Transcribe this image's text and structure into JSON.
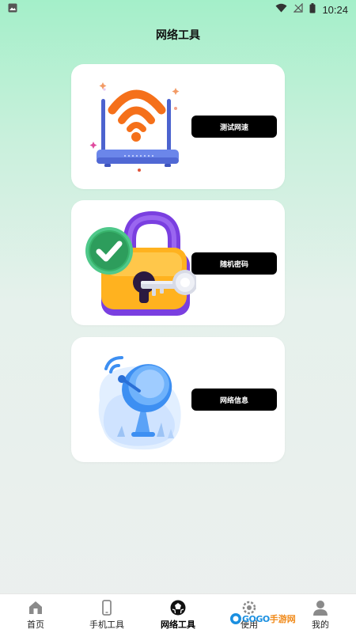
{
  "status_bar": {
    "time": "10:24",
    "icons": [
      "image-icon",
      "wifi-icon",
      "signal-off-icon",
      "battery-icon"
    ]
  },
  "header": {
    "title": "网络工具"
  },
  "cards": [
    {
      "button_label": "测试网速",
      "illustration": "wifi-router-icon"
    },
    {
      "button_label": "随机密码",
      "illustration": "lock-key-icon"
    },
    {
      "button_label": "网络信息",
      "illustration": "satellite-dish-icon"
    }
  ],
  "tabbar": {
    "items": [
      {
        "label": "首页",
        "icon": "home-icon",
        "active": false
      },
      {
        "label": "手机工具",
        "icon": "phone-icon",
        "active": false
      },
      {
        "label": "网络工具",
        "icon": "network-ball-icon",
        "active": true
      },
      {
        "label": "使用",
        "icon": "gear-icon",
        "active": false
      },
      {
        "label": "我的",
        "icon": "user-icon",
        "active": false
      }
    ]
  },
  "watermark": {
    "latin": "GOGO",
    "cn": "手游网"
  },
  "colors": {
    "accent_orange": "#f5701a",
    "router_blue": "#5b78e0",
    "lock_purple": "#7a3fe0",
    "lock_yellow": "#ffb21f",
    "check_green": "#38b36b",
    "dish_blue": "#3d8ff2"
  }
}
